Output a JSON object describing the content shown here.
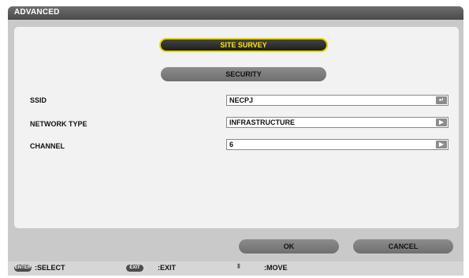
{
  "window": {
    "title": "ADVANCED"
  },
  "buttons": {
    "site_survey": "SITE SURVEY",
    "security": "SECURITY",
    "ok": "OK",
    "cancel": "CANCEL"
  },
  "fields": [
    {
      "label": "SSID",
      "value": "NECPJ",
      "button_icon": "enter-icon"
    },
    {
      "label": "NETWORK TYPE",
      "value": "INFRASTRUCTURE",
      "button_icon": "play-arrow-icon"
    },
    {
      "label": "CHANNEL",
      "value": "6",
      "button_icon": "play-arrow-icon"
    }
  ],
  "footer": {
    "select_key": "ENTER",
    "select_text": ":SELECT",
    "exit_key": "EXIT",
    "exit_text": ":EXIT",
    "move_icon": "up-down-arrows-icon",
    "move_text": ":MOVE"
  },
  "colors": {
    "selected_border": "#e3d700",
    "selected_text": "#ffe800",
    "title_bar": "#555555",
    "button": "#808080"
  }
}
